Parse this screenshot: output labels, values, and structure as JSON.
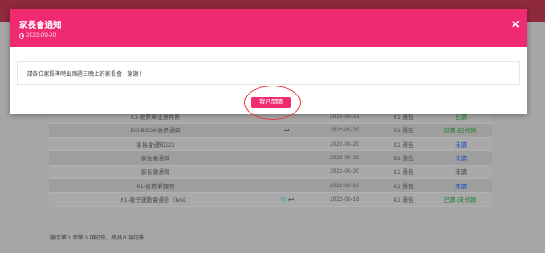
{
  "modal": {
    "title": "家長會通知",
    "date": "2022-09-20",
    "close_label": "×",
    "message": "請各位家長準時出席週三晚上的家長會，謝謝！",
    "read_button": "我已閱讀"
  },
  "table": {
    "rows": [
      {
        "title": "K1-收費單注意件照",
        "icon": "",
        "date": "2022-09-21",
        "type": "K1 通告",
        "status": "已讀",
        "status_color": "green"
      },
      {
        "title": "EVI BOOK收費通知",
        "icon": "↩",
        "date": "2022-09-20",
        "type": "K1 通告",
        "status": "已讀 (已付款)",
        "status_color": "green"
      },
      {
        "title": "家長會通知222",
        "icon": "",
        "date": "2022-09-20",
        "type": "K1 通告",
        "status": "未讀",
        "status_color": "blue"
      },
      {
        "title": "家長會通知",
        "icon": "",
        "date": "2022-09-20",
        "type": "K1 通告",
        "status": "未讀",
        "status_color": "blue"
      },
      {
        "title": "家長會通知",
        "icon": "",
        "date": "2022-09-20",
        "type": "K1 通告",
        "status": "未讀",
        "status_color": "gray"
      },
      {
        "title": "K1-收費單簽照",
        "icon": "",
        "date": "2022-09-16",
        "type": "K1 通告",
        "status": "未讀",
        "status_color": "blue"
      },
      {
        "title": "K1-親子運動會通告（test）",
        "icon": "📎↩",
        "date": "2022-09-16",
        "type": "K1 通告",
        "status": "已讀 (未付款)",
        "status_color": "green"
      }
    ]
  },
  "footer": {
    "summary": "顯示第 1 到第 8 項記錄，總共 8 項記錄"
  },
  "colors": {
    "accent": "#ef2a70",
    "ring": "#e23a3a"
  }
}
